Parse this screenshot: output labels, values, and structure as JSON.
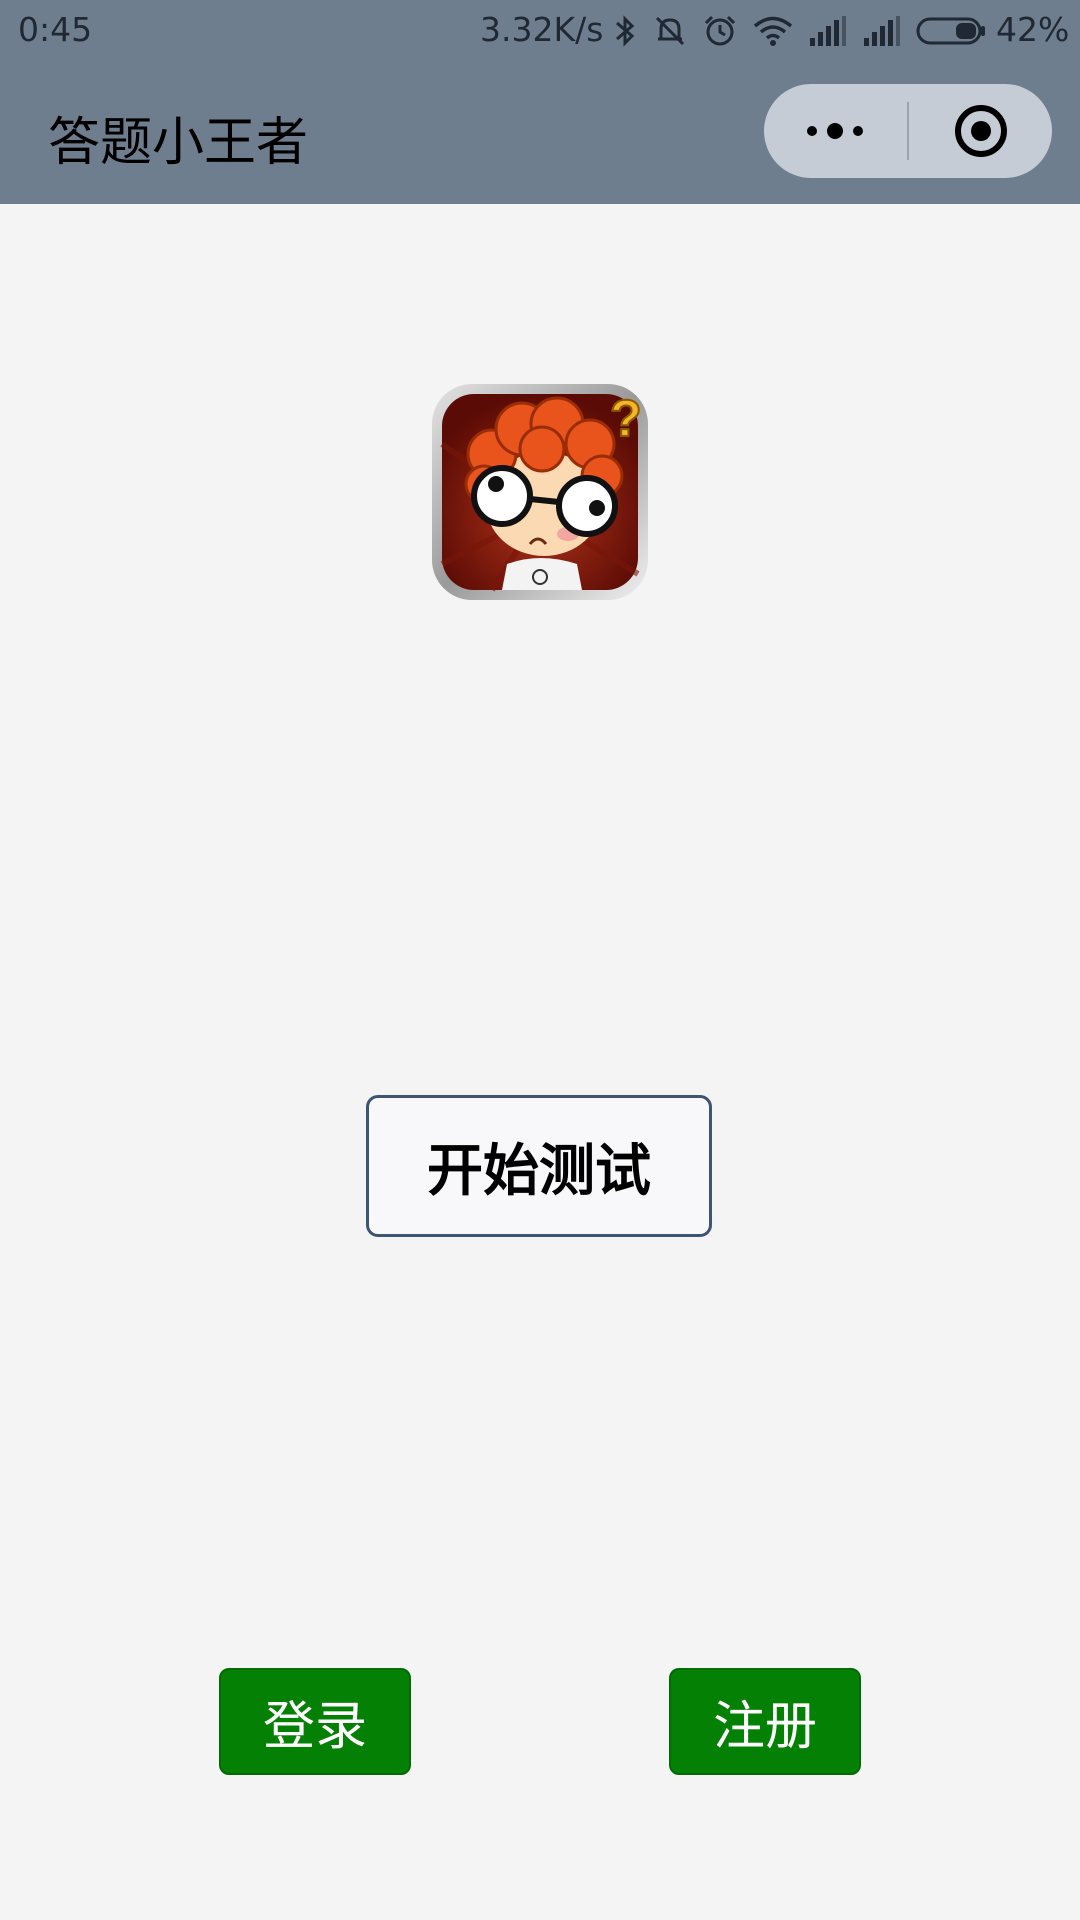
{
  "status_bar": {
    "time": "0:45",
    "network_speed": "3.32K/s",
    "battery_percent": "42%",
    "battery_level": 0.42,
    "icons": [
      "bluetooth-icon",
      "mute-icon",
      "alarm-icon",
      "wifi-icon",
      "signal-icon",
      "signal-icon",
      "battery-icon"
    ]
  },
  "header": {
    "title": "答题小王者",
    "capsule": {
      "more_icon": "more-dots-icon",
      "close_icon": "target-icon"
    }
  },
  "main": {
    "logo_icon": "quiz-avatar-logo",
    "start_button": "开始测试"
  },
  "bottom": {
    "login_button": "登录",
    "register_button": "注册"
  },
  "colors": {
    "header_bg": "#6f7e8f",
    "page_bg": "#f4f4f5",
    "green_button": "#048104",
    "start_border": "#3d5572"
  }
}
